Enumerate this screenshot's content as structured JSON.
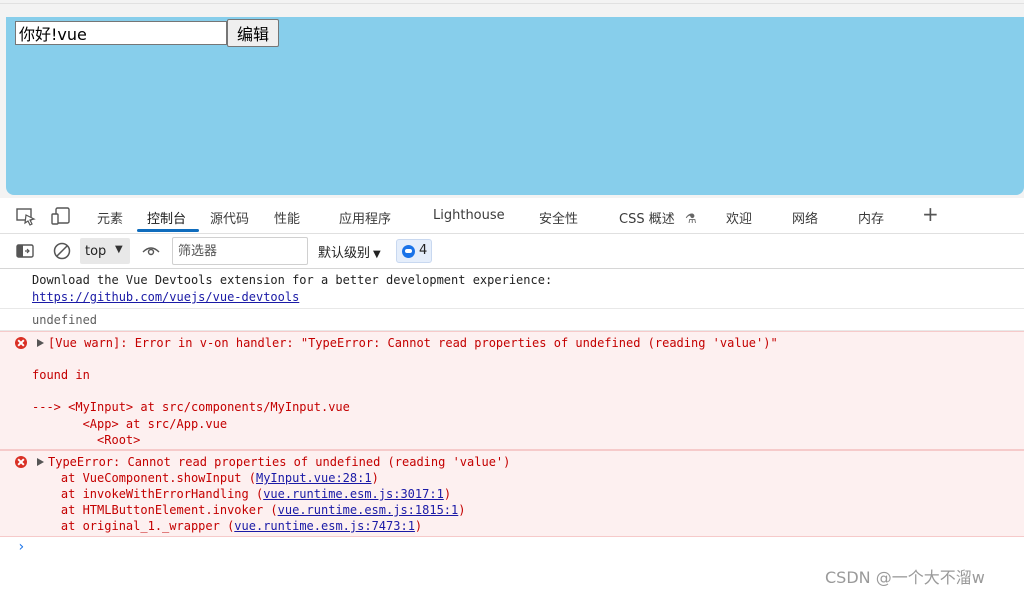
{
  "page": {
    "input_value": "你好!vue",
    "edit_button_label": "编辑"
  },
  "devtools": {
    "tabs": [
      {
        "label": "元素"
      },
      {
        "label": "控制台",
        "active": true
      },
      {
        "label": "源代码"
      },
      {
        "label": "性能"
      },
      {
        "label": "应用程序"
      },
      {
        "label": "Lighthouse"
      },
      {
        "label": "安全性"
      },
      {
        "label": "CSS 概述"
      },
      {
        "label": "欢迎"
      },
      {
        "label": "网络"
      },
      {
        "label": "内存"
      }
    ],
    "add_tab_symbol": "+",
    "flask_symbol": "⚗",
    "icons": [
      "inspect-element-icon",
      "device-toolbar-icon"
    ]
  },
  "toolbar": {
    "context": "top",
    "filter_placeholder": "筛选器",
    "levels_label": "默认级别",
    "issues_count": "4",
    "icons": [
      "sidebar-toggle-icon",
      "clear-console-icon",
      "live-expression-eye-icon",
      "issues-icon"
    ]
  },
  "console": {
    "info": {
      "line1": "Download the Vue Devtools extension for a better development experience:",
      "link": "https://github.com/vuejs/vue-devtools"
    },
    "result": "undefined",
    "error1": {
      "line1": "[Vue warn]: Error in v-on handler: \"TypeError: Cannot read properties of undefined (reading 'value')\"",
      "line2": "found in",
      "line3": "---> <MyInput> at src/components/MyInput.vue",
      "line4": "       <App> at src/App.vue",
      "line5": "         <Root>"
    },
    "error2": {
      "line1": "TypeError: Cannot read properties of undefined (reading 'value')",
      "frames": [
        {
          "prefix": "    at VueComponent.showInput (",
          "link": "MyInput.vue:28:1",
          "suffix": ")"
        },
        {
          "prefix": "    at invokeWithErrorHandling (",
          "link": "vue.runtime.esm.js:3017:1",
          "suffix": ")"
        },
        {
          "prefix": "    at HTMLButtonElement.invoker (",
          "link": "vue.runtime.esm.js:1815:1",
          "suffix": ")"
        },
        {
          "prefix": "    at original_1._wrapper (",
          "link": "vue.runtime.esm.js:7473:1",
          "suffix": ")"
        }
      ]
    },
    "prompt_symbol": "›"
  },
  "watermark": "CSDN @一个大不溜w",
  "colors": {
    "page_background": "#87ceeb",
    "error_text": "#c40000",
    "error_background": "#fdf0f0",
    "link": "#1a1aa6",
    "active_tab_underline": "#0f6cbd"
  }
}
